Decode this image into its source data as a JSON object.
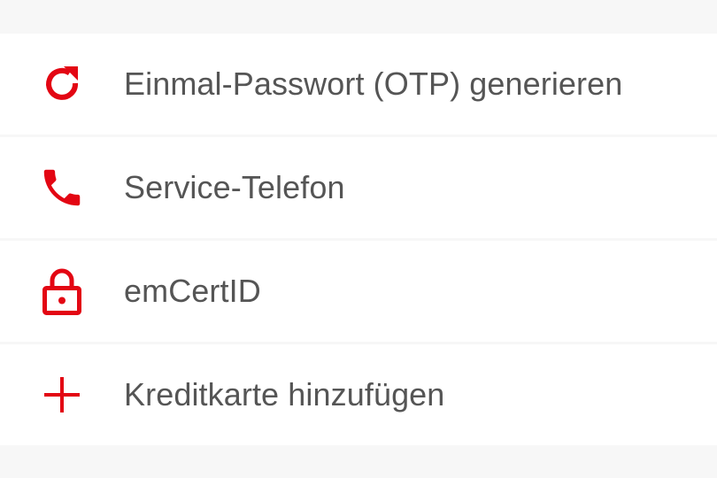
{
  "accent_color": "#e30613",
  "menu": {
    "items": [
      {
        "label": "Einmal-Passwort (OTP) generieren",
        "icon": "refresh-icon"
      },
      {
        "label": "Service-Telefon",
        "icon": "phone-icon"
      },
      {
        "label": "emCertID",
        "icon": "lock-icon"
      },
      {
        "label": "Kreditkarte hinzufügen",
        "icon": "plus-icon"
      }
    ]
  }
}
